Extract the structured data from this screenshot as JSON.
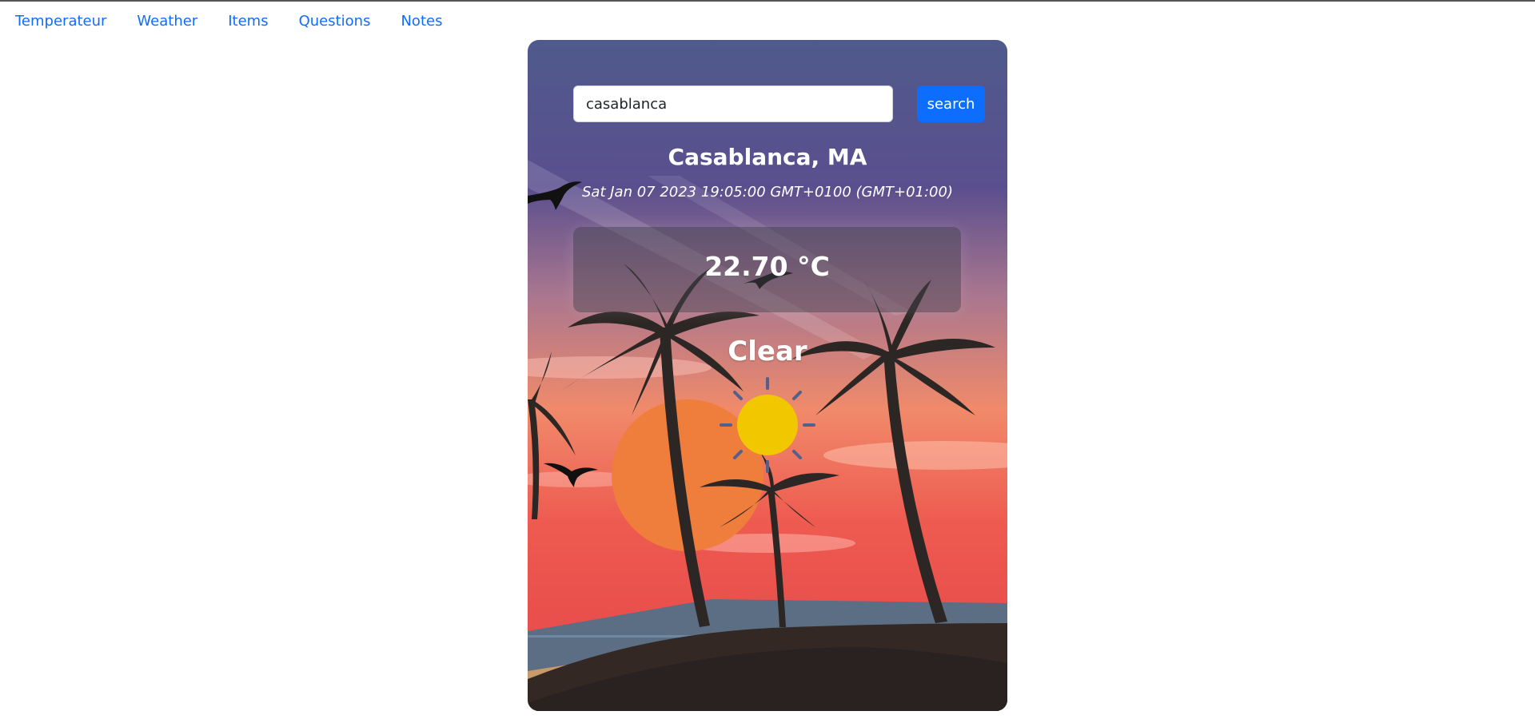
{
  "nav": {
    "items": [
      {
        "label": "Temperateur"
      },
      {
        "label": "Weather"
      },
      {
        "label": "Items"
      },
      {
        "label": "Questions"
      },
      {
        "label": "Notes"
      }
    ]
  },
  "search": {
    "value": "casablanca",
    "button_label": "search"
  },
  "weather": {
    "city": "Casablanca, MA",
    "date": "Sat Jan 07 2023 19:05:00 GMT+0100 (GMT+01:00)",
    "temperature": "22.70 °C",
    "condition": "Clear",
    "icon": "sun-icon"
  },
  "colors": {
    "link": "#0d6efd",
    "button": "#0d6efd",
    "sun": "#f1c800",
    "sky_top": "#4f5a8c",
    "sky_bottom": "#e94f4c"
  }
}
